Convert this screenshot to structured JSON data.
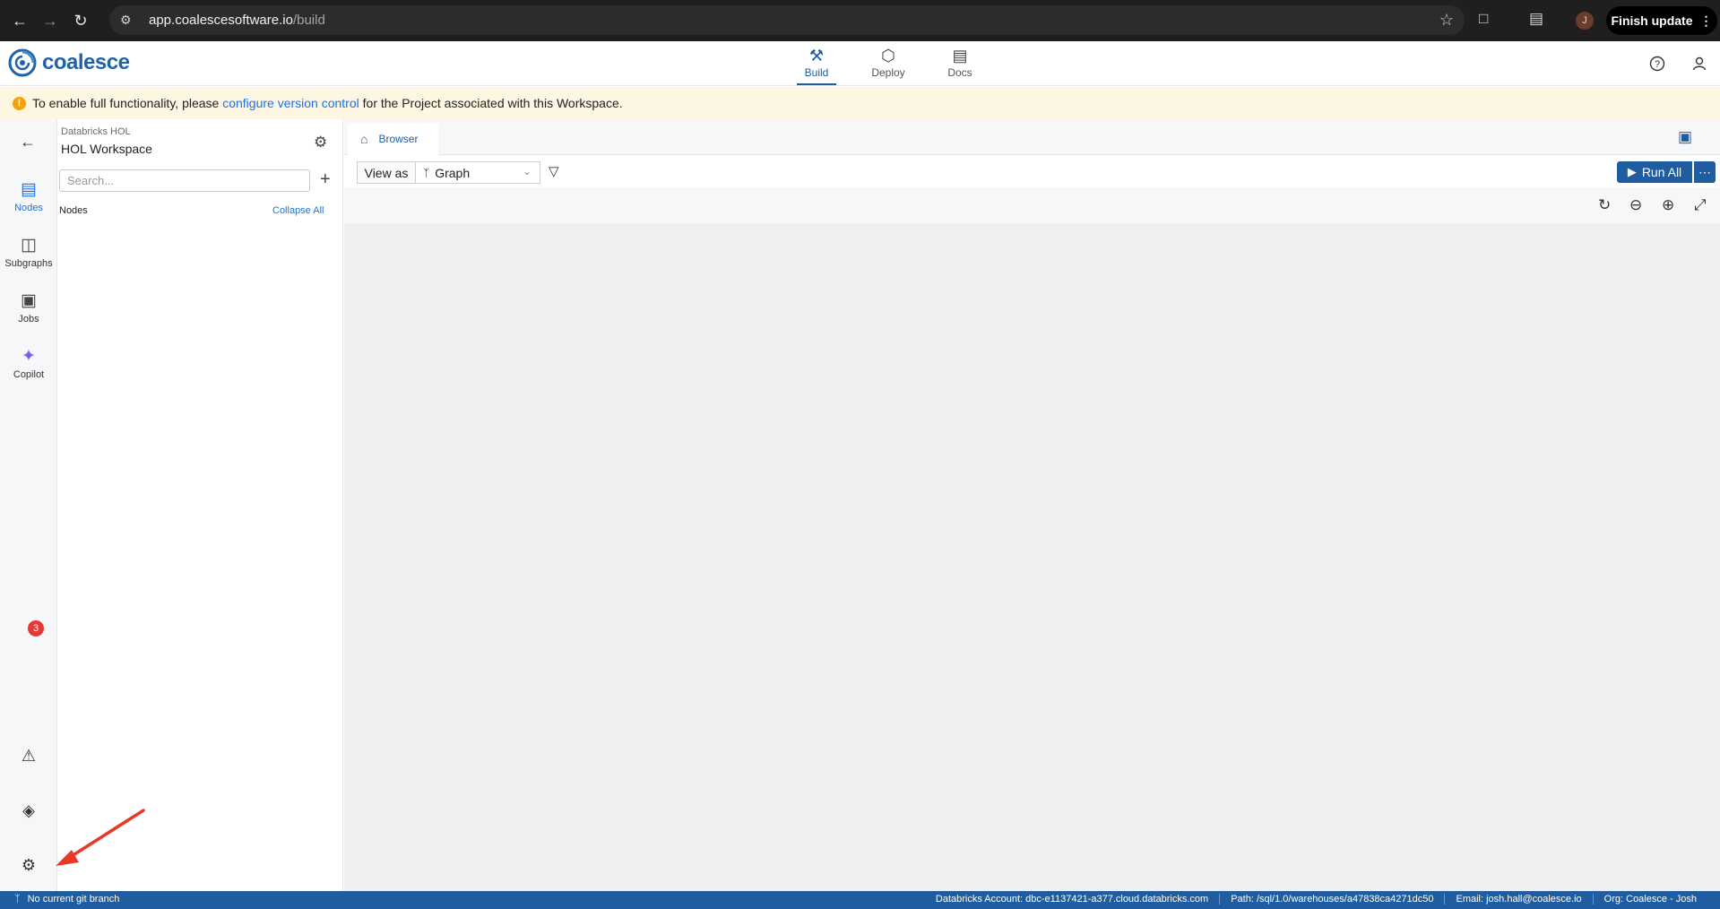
{
  "browser": {
    "url_host": "app.coalescesoftware.io",
    "url_path": "/build",
    "profile_initial": "J",
    "finish_update_label": "Finish update"
  },
  "header": {
    "logo_text": "coalesce",
    "tabs": [
      {
        "label": "Build",
        "icon": "build-icon",
        "active": true
      },
      {
        "label": "Deploy",
        "icon": "deploy-icon",
        "active": false
      },
      {
        "label": "Docs",
        "icon": "docs-icon",
        "active": false
      }
    ]
  },
  "banner": {
    "prefix": "To enable full functionality, please ",
    "link": "configure version control",
    "suffix": " for the Project associated with this Workspace."
  },
  "rail": {
    "items": [
      {
        "label": "Nodes",
        "icon": "nodes-icon",
        "active": true
      },
      {
        "label": "Subgraphs",
        "icon": "subgraphs-icon",
        "active": false
      },
      {
        "label": "Jobs",
        "icon": "jobs-icon",
        "active": false
      },
      {
        "label": "Copilot",
        "icon": "copilot-icon",
        "active": false
      }
    ],
    "problems_count": "3"
  },
  "panel": {
    "environment": "Databricks HOL",
    "workspace": "HOL Workspace",
    "search_placeholder": "Search...",
    "nodes_label": "Nodes",
    "collapse_all": "Collapse All"
  },
  "main": {
    "tab_label": "Browser",
    "view_as_label": "View as",
    "view_option": "Graph",
    "run_all_label": "Run All"
  },
  "status": {
    "branch": "No current git branch",
    "account": "Databricks Account: dbc-e1137421-a377.cloud.databricks.com",
    "path": "Path: /sql/1.0/warehouses/a47838ca4271dc50",
    "email": "Email: josh.hall@coalesce.io",
    "org": "Org: Coalesce - Josh"
  },
  "colors": {
    "brand": "#1f5ca0",
    "link": "#1a73e8",
    "banner_bg": "#fdf6e3",
    "annotation": "#e8382b"
  }
}
